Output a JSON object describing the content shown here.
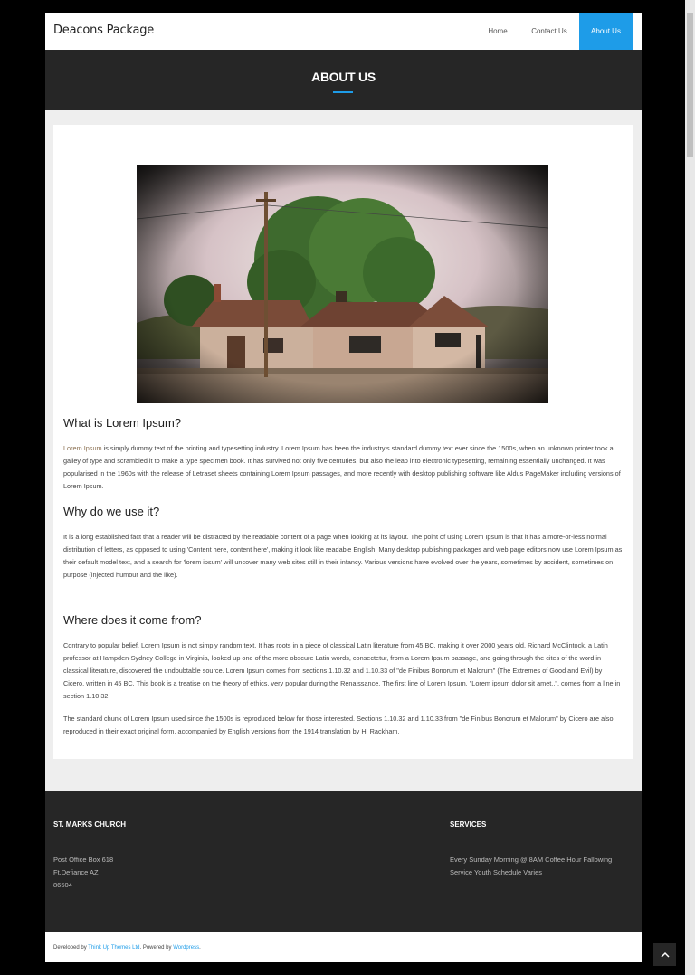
{
  "header": {
    "site_title": "Deacons Package",
    "nav": [
      "Home",
      "Contact Us",
      "About Us"
    ]
  },
  "title_band": {
    "title": "ABOUT US"
  },
  "content": {
    "sections": [
      {
        "heading": "What is Lorem Ipsum?",
        "paragraphs": [
          {
            "lead": "Lorem Ipsum",
            "text": " is simply dummy text of the printing and typesetting industry. Lorem Ipsum has been the industry's standard dummy text ever since the 1500s, when an unknown printer took a galley of type and scrambled it to make a type specimen book. It has survived not only five centuries, but also the leap into electronic typesetting, remaining essentially unchanged. It was popularised in the 1960s with the release of Letraset sheets containing Lorem Ipsum passages, and more recently with desktop publishing software like Aldus PageMaker including versions of Lorem Ipsum."
          }
        ]
      },
      {
        "heading": "Why do we use it?",
        "paragraphs": [
          {
            "text": "It is a long established fact that a reader will be distracted by the readable content of a page when looking at its layout. The point of using Lorem Ipsum is that it has a more-or-less normal distribution of letters, as opposed to using 'Content here, content here', making it look like readable English. Many desktop publishing packages and web page editors now use Lorem Ipsum as their default model text, and a search for 'lorem ipsum' will uncover many web sites still in their infancy. Various versions have evolved over the years, sometimes by accident, sometimes on purpose (injected humour and the like)."
          }
        ]
      },
      {
        "heading": "Where does it come from?",
        "paragraphs": [
          {
            "text": "Contrary to popular belief, Lorem Ipsum is not simply random text. It has roots in a piece of classical Latin literature from 45 BC, making it over 2000 years old. Richard McClintock, a Latin professor at Hampden-Sydney College in Virginia, looked up one of the more obscure Latin words, consectetur, from a Lorem Ipsum passage, and going through the cites of the word in classical literature, discovered the undoubtable source. Lorem Ipsum comes from sections 1.10.32 and 1.10.33 of \"de Finibus Bonorum et Malorum\" (The Extremes of Good and Evil) by Cicero, written in 45 BC. This book is a treatise on the theory of ethics, very popular during the Renaissance. The first line of Lorem Ipsum, \"Lorem ipsum dolor sit amet..\", comes from a line in section 1.10.32."
          },
          {
            "text": "The standard chunk of Lorem Ipsum used since the 1500s is reproduced below for those interested. Sections 1.10.32 and 1.10.33 from \"de Finibus Bonorum et Malorum\" by Cicero are also reproduced in their exact original form, accompanied by English versions from the 1914 translation by H. Rackham."
          }
        ]
      }
    ]
  },
  "footer": {
    "church": {
      "heading": "ST. MARKS CHURCH",
      "lines": [
        "Post Office Box 618",
        "Ft.Defiance AZ",
        "86504"
      ]
    },
    "services": {
      "heading": "SERVICES",
      "lines": [
        "Every Sunday Morning @ 8AM Coffee Hour Fallowing",
        "Service Youth Schedule Varies"
      ]
    }
  },
  "credits": {
    "prefix": "Developed by ",
    "developer": "Think Up Themes Ltd",
    "middle": ". Powered by ",
    "platform": "Wordpress",
    "suffix": "."
  },
  "colors": {
    "accent": "#1e9ce8",
    "dark_band": "#262626",
    "page_bg": "#eeeeee"
  },
  "icons": {
    "scroll_top": "chevron-up-icon"
  }
}
